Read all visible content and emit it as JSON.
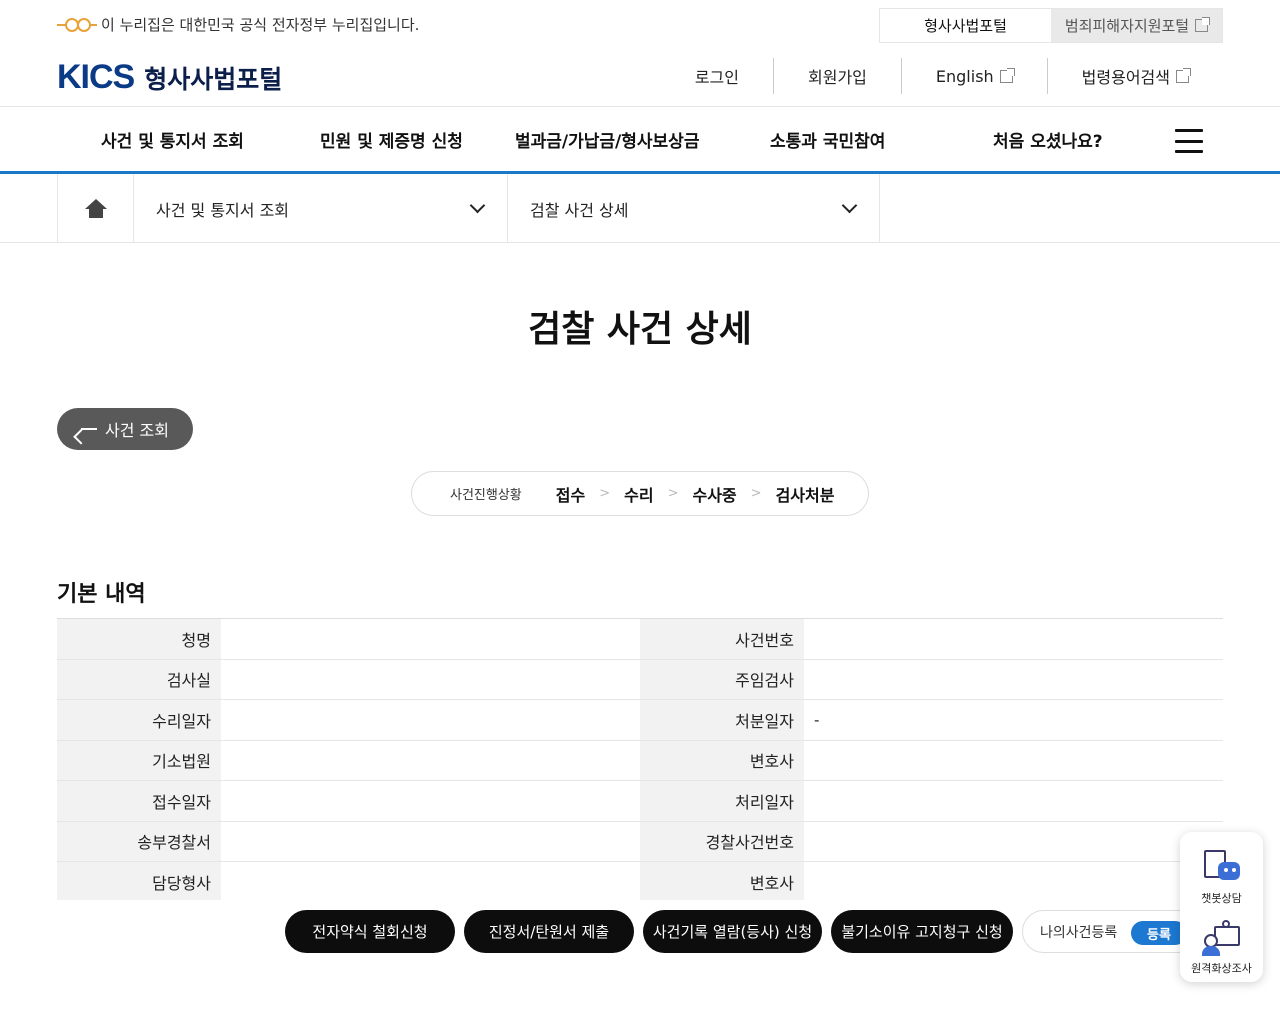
{
  "gov_banner": {
    "text": "이 누리집은 대한민국 공식 전자정부 누리집입니다."
  },
  "portal_tabs": [
    {
      "label": "형사사법포털"
    },
    {
      "label": "범죄피해자지원포털"
    }
  ],
  "header": {
    "logo_mark": "KICS",
    "logo_text": "형사사법포털"
  },
  "util_nav": [
    {
      "label": "로그인"
    },
    {
      "label": "회원가입"
    },
    {
      "label": "English"
    },
    {
      "label": "법령용어검색"
    }
  ],
  "main_nav": [
    {
      "label": "사건 및 통지서 조회"
    },
    {
      "label": "민원 및 제증명 신청"
    },
    {
      "label": "벌과금/가납금/형사보상금"
    },
    {
      "label": "소통과 국민참여"
    },
    {
      "label": "처음 오셨나요?"
    }
  ],
  "breadcrumb": {
    "level1": "사건 및 통지서 조회",
    "level2": "검찰 사건 상세"
  },
  "page_title": "검찰 사건 상세",
  "back_button": "사건 조회",
  "progress": {
    "label": "사건진행상황",
    "steps": [
      "접수",
      "수리",
      "수사중",
      "검사처분"
    ],
    "separator": ">"
  },
  "section_title": "기본 내역",
  "details": [
    {
      "l1": "청명",
      "v1": "",
      "l2": "사건번호",
      "v2": ""
    },
    {
      "l1": "검사실",
      "v1": "",
      "l2": "주임검사",
      "v2": ""
    },
    {
      "l1": "수리일자",
      "v1": "",
      "l2": "처분일자",
      "v2": "-"
    },
    {
      "l1": "기소법원",
      "v1": "",
      "l2": "변호사",
      "v2": ""
    },
    {
      "l1": "접수일자",
      "v1": "",
      "l2": "처리일자",
      "v2": ""
    },
    {
      "l1": "송부경찰서",
      "v1": "",
      "l2": "경찰사건번호",
      "v2": ""
    },
    {
      "l1": "담당형사",
      "v1": "",
      "l2": "변호사",
      "v2": ""
    }
  ],
  "actions": [
    {
      "label": "전자약식 철회신청"
    },
    {
      "label": "진정서/탄원서 제출"
    },
    {
      "label": "사건기록 열람(등사) 신청"
    },
    {
      "label": "불기소이유 고지청구 신청"
    }
  ],
  "my_case": {
    "label": "나의사건등록",
    "button": "등록"
  },
  "float": [
    {
      "label": "챗봇상담",
      "icon": "chatbot-icon"
    },
    {
      "label": "원격화상조사",
      "icon": "video-call-icon"
    }
  ],
  "colors": {
    "accent": "#1b78c8",
    "brand": "#0b3a86",
    "dark_button": "#0d0d0d"
  }
}
